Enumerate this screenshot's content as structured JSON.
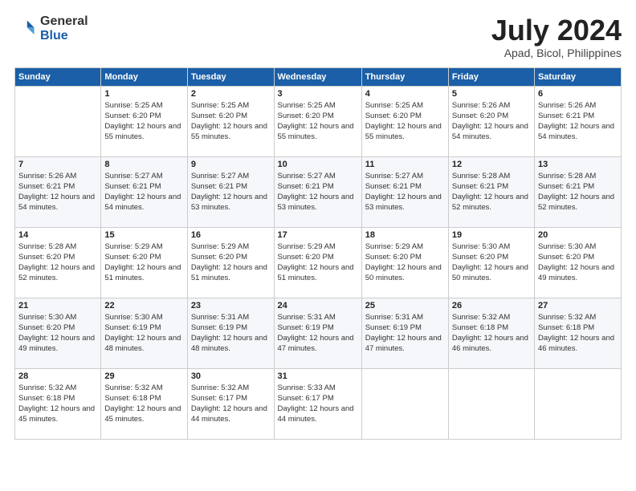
{
  "header": {
    "logo_general": "General",
    "logo_blue": "Blue",
    "month_title": "July 2024",
    "location": "Apad, Bicol, Philippines"
  },
  "weekdays": [
    "Sunday",
    "Monday",
    "Tuesday",
    "Wednesday",
    "Thursday",
    "Friday",
    "Saturday"
  ],
  "weeks": [
    [
      {
        "day": "",
        "sunrise": "",
        "sunset": "",
        "daylight": ""
      },
      {
        "day": "1",
        "sunrise": "5:25 AM",
        "sunset": "6:20 PM",
        "daylight": "12 hours and 55 minutes."
      },
      {
        "day": "2",
        "sunrise": "5:25 AM",
        "sunset": "6:20 PM",
        "daylight": "12 hours and 55 minutes."
      },
      {
        "day": "3",
        "sunrise": "5:25 AM",
        "sunset": "6:20 PM",
        "daylight": "12 hours and 55 minutes."
      },
      {
        "day": "4",
        "sunrise": "5:25 AM",
        "sunset": "6:20 PM",
        "daylight": "12 hours and 55 minutes."
      },
      {
        "day": "5",
        "sunrise": "5:26 AM",
        "sunset": "6:20 PM",
        "daylight": "12 hours and 54 minutes."
      },
      {
        "day": "6",
        "sunrise": "5:26 AM",
        "sunset": "6:21 PM",
        "daylight": "12 hours and 54 minutes."
      }
    ],
    [
      {
        "day": "7",
        "sunrise": "5:26 AM",
        "sunset": "6:21 PM",
        "daylight": "12 hours and 54 minutes."
      },
      {
        "day": "8",
        "sunrise": "5:27 AM",
        "sunset": "6:21 PM",
        "daylight": "12 hours and 54 minutes."
      },
      {
        "day": "9",
        "sunrise": "5:27 AM",
        "sunset": "6:21 PM",
        "daylight": "12 hours and 53 minutes."
      },
      {
        "day": "10",
        "sunrise": "5:27 AM",
        "sunset": "6:21 PM",
        "daylight": "12 hours and 53 minutes."
      },
      {
        "day": "11",
        "sunrise": "5:27 AM",
        "sunset": "6:21 PM",
        "daylight": "12 hours and 53 minutes."
      },
      {
        "day": "12",
        "sunrise": "5:28 AM",
        "sunset": "6:21 PM",
        "daylight": "12 hours and 52 minutes."
      },
      {
        "day": "13",
        "sunrise": "5:28 AM",
        "sunset": "6:21 PM",
        "daylight": "12 hours and 52 minutes."
      }
    ],
    [
      {
        "day": "14",
        "sunrise": "5:28 AM",
        "sunset": "6:20 PM",
        "daylight": "12 hours and 52 minutes."
      },
      {
        "day": "15",
        "sunrise": "5:29 AM",
        "sunset": "6:20 PM",
        "daylight": "12 hours and 51 minutes."
      },
      {
        "day": "16",
        "sunrise": "5:29 AM",
        "sunset": "6:20 PM",
        "daylight": "12 hours and 51 minutes."
      },
      {
        "day": "17",
        "sunrise": "5:29 AM",
        "sunset": "6:20 PM",
        "daylight": "12 hours and 51 minutes."
      },
      {
        "day": "18",
        "sunrise": "5:29 AM",
        "sunset": "6:20 PM",
        "daylight": "12 hours and 50 minutes."
      },
      {
        "day": "19",
        "sunrise": "5:30 AM",
        "sunset": "6:20 PM",
        "daylight": "12 hours and 50 minutes."
      },
      {
        "day": "20",
        "sunrise": "5:30 AM",
        "sunset": "6:20 PM",
        "daylight": "12 hours and 49 minutes."
      }
    ],
    [
      {
        "day": "21",
        "sunrise": "5:30 AM",
        "sunset": "6:20 PM",
        "daylight": "12 hours and 49 minutes."
      },
      {
        "day": "22",
        "sunrise": "5:30 AM",
        "sunset": "6:19 PM",
        "daylight": "12 hours and 48 minutes."
      },
      {
        "day": "23",
        "sunrise": "5:31 AM",
        "sunset": "6:19 PM",
        "daylight": "12 hours and 48 minutes."
      },
      {
        "day": "24",
        "sunrise": "5:31 AM",
        "sunset": "6:19 PM",
        "daylight": "12 hours and 47 minutes."
      },
      {
        "day": "25",
        "sunrise": "5:31 AM",
        "sunset": "6:19 PM",
        "daylight": "12 hours and 47 minutes."
      },
      {
        "day": "26",
        "sunrise": "5:32 AM",
        "sunset": "6:18 PM",
        "daylight": "12 hours and 46 minutes."
      },
      {
        "day": "27",
        "sunrise": "5:32 AM",
        "sunset": "6:18 PM",
        "daylight": "12 hours and 46 minutes."
      }
    ],
    [
      {
        "day": "28",
        "sunrise": "5:32 AM",
        "sunset": "6:18 PM",
        "daylight": "12 hours and 45 minutes."
      },
      {
        "day": "29",
        "sunrise": "5:32 AM",
        "sunset": "6:18 PM",
        "daylight": "12 hours and 45 minutes."
      },
      {
        "day": "30",
        "sunrise": "5:32 AM",
        "sunset": "6:17 PM",
        "daylight": "12 hours and 44 minutes."
      },
      {
        "day": "31",
        "sunrise": "5:33 AM",
        "sunset": "6:17 PM",
        "daylight": "12 hours and 44 minutes."
      },
      {
        "day": "",
        "sunrise": "",
        "sunset": "",
        "daylight": ""
      },
      {
        "day": "",
        "sunrise": "",
        "sunset": "",
        "daylight": ""
      },
      {
        "day": "",
        "sunrise": "",
        "sunset": "",
        "daylight": ""
      }
    ]
  ]
}
